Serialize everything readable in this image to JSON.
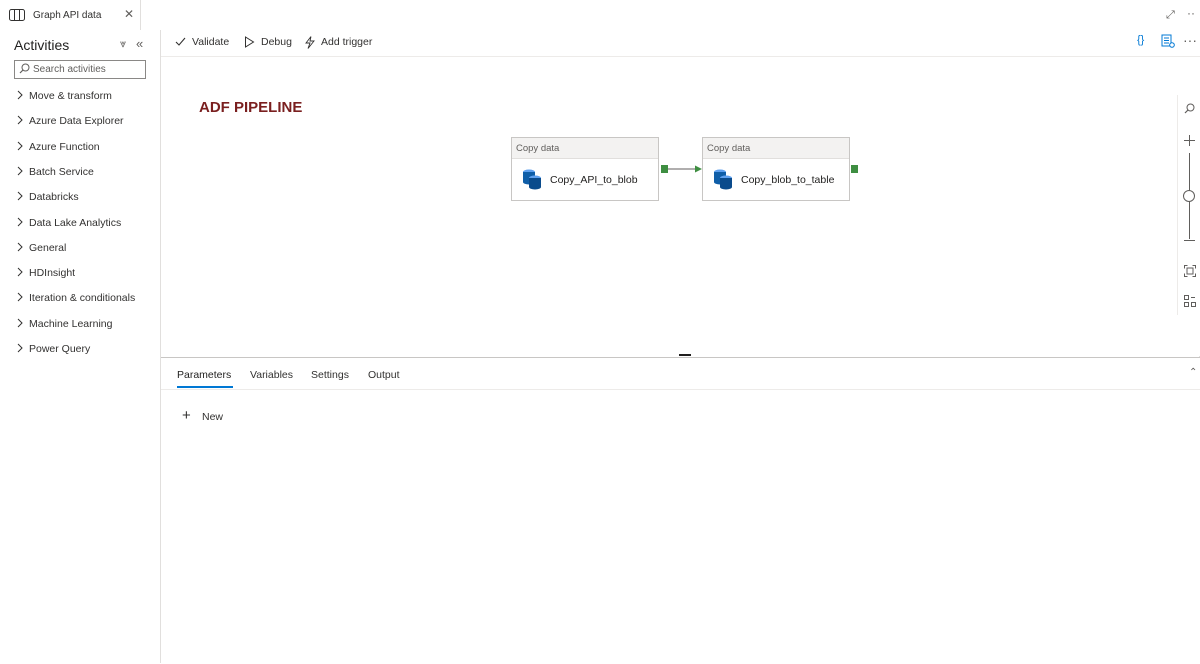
{
  "tab": {
    "title": "Graph API data",
    "close_glyph": "✕"
  },
  "activities": {
    "title": "Activities",
    "search_placeholder": "Search activities",
    "categories": [
      "Move & transform",
      "Azure Data Explorer",
      "Azure Function",
      "Batch Service",
      "Databricks",
      "Data Lake Analytics",
      "General",
      "HDInsight",
      "Iteration & conditionals",
      "Machine Learning",
      "Power Query"
    ]
  },
  "toolbar": {
    "validate": "Validate",
    "debug": "Debug",
    "add_trigger": "Add trigger",
    "code_glyph": "{}",
    "more_glyph": "···"
  },
  "canvas": {
    "annotation": "ADF PIPELINE",
    "activities": [
      {
        "type": "Copy data",
        "name": "Copy_API_to_blob"
      },
      {
        "type": "Copy data",
        "name": "Copy_blob_to_table"
      }
    ],
    "zoom_level": 0.5
  },
  "bottom_panel": {
    "tabs": [
      "Parameters",
      "Variables",
      "Settings",
      "Output"
    ],
    "active_tab": "Parameters",
    "new_label": "New"
  },
  "colors": {
    "accent": "#0078d4",
    "success_port": "#3e8e41",
    "annotation": "#7a1f1f"
  },
  "icons": {
    "tab": "pipeline-icon",
    "search": "search-icon",
    "category": "chevron-right-icon",
    "validate": "checkmark-icon",
    "debug": "play-icon",
    "add_trigger": "lightning-icon",
    "code": "code-braces-icon",
    "properties": "properties-icon",
    "activity": "copy-data-icon"
  }
}
